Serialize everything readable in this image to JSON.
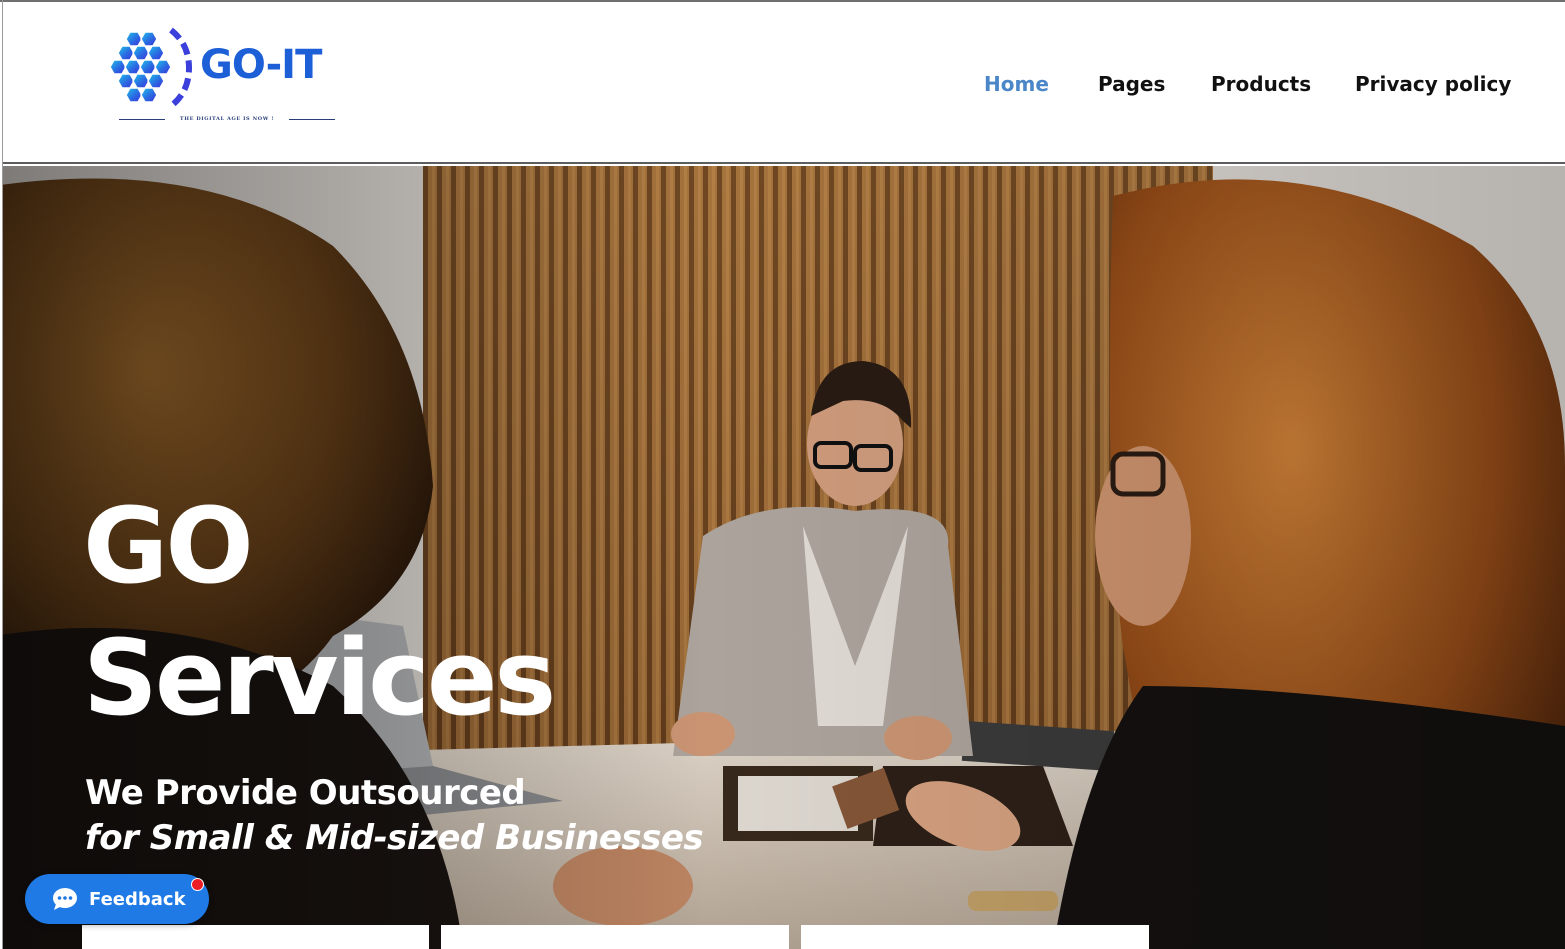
{
  "brand": {
    "logo_text": "GO-IT",
    "tagline": "THE DIGITAL AGE IS NOW !",
    "logo_colors": [
      "#1fb4e8",
      "#2a67e0",
      "#3a2fd6"
    ]
  },
  "nav": {
    "items": [
      {
        "label": "Home",
        "active": true
      },
      {
        "label": "Pages",
        "active": false
      },
      {
        "label": "Products",
        "active": false
      },
      {
        "label": "Privacy policy",
        "active": false
      }
    ],
    "active_color": "#4a86c8"
  },
  "hero": {
    "title_line_1": "GO",
    "title_line_2": "Services",
    "subtitle_line_1": "We Provide Outsourced",
    "subtitle_line_2": "for Small & Mid-sized Businesses",
    "image_description_icon": "office-meeting-photo"
  },
  "feedback": {
    "label": "Feedback",
    "icon": "chat-bubble-icon",
    "color": "#1f7ae6",
    "badge_color": "#ee1c25"
  }
}
